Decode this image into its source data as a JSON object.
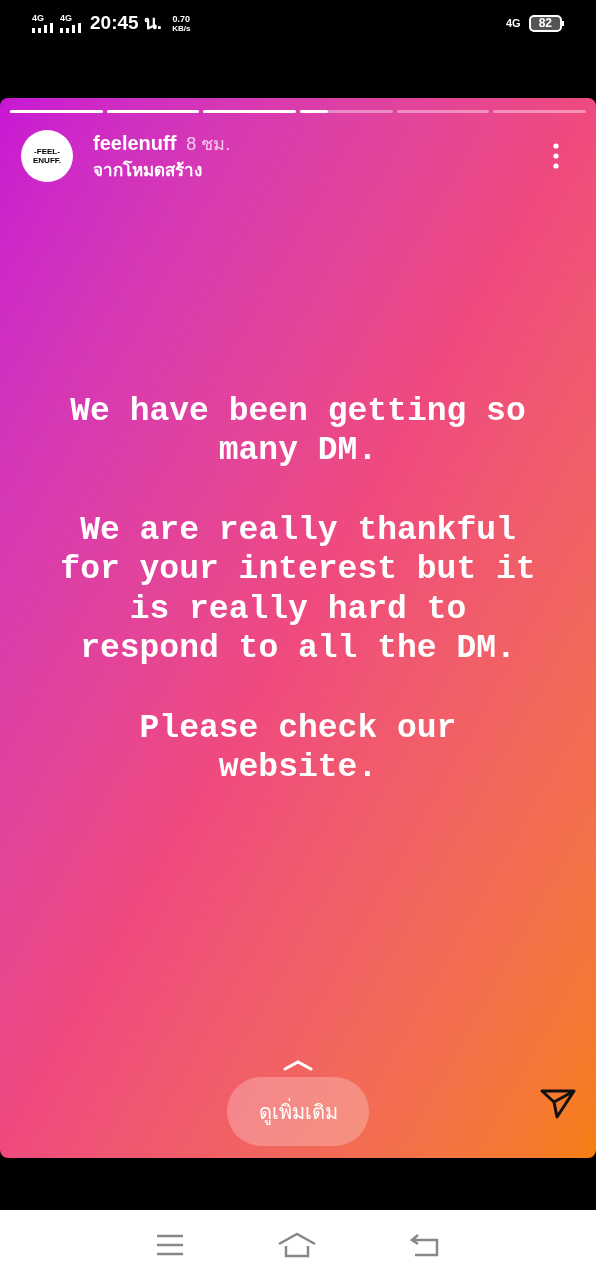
{
  "status_bar": {
    "sim_labels": [
      "4G",
      "4G"
    ],
    "time": "20:45 น.",
    "speed_value": "0.70",
    "speed_unit": "KB/s",
    "network": "4G",
    "battery": "82"
  },
  "story": {
    "segments": [
      {
        "level": 1
      },
      {
        "level": 1
      },
      {
        "level": 1
      },
      {
        "level": 0.3
      },
      {
        "level": 0
      },
      {
        "level": 0
      }
    ],
    "avatar_text": [
      "-FEEL-",
      "ENUFF."
    ],
    "username": "feelenuff",
    "time": "8 ชม.",
    "subtitle": "จากโหมดสร้าง",
    "paragraphs": [
      "We have been getting so many DM.",
      "We are really thankful for your interest but it is really hard to respond to all the DM.",
      "Please check our website."
    ],
    "more_button": "ดูเพิ่มเติม"
  }
}
